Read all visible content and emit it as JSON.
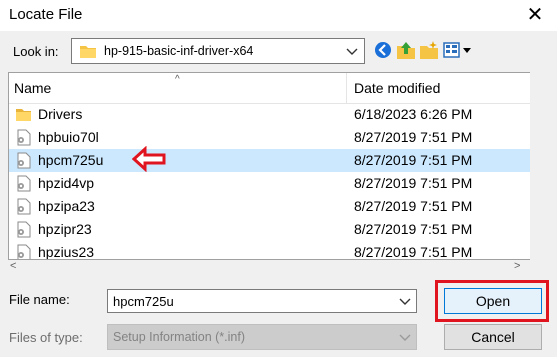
{
  "window": {
    "title": "Locate File",
    "close_glyph": "✕"
  },
  "lookin": {
    "label": "Look in:",
    "value": "hp-915-basic-inf-driver-x64"
  },
  "toolbar": {
    "icons": [
      "back-icon",
      "up-folder-icon",
      "new-folder-icon",
      "view-menu-icon"
    ]
  },
  "list": {
    "columns": {
      "name": "Name",
      "date": "Date modified"
    },
    "sort_glyph": "^",
    "rows": [
      {
        "name": "Drivers",
        "date": "6/18/2023 6:26 PM",
        "type": "folder",
        "selected": false
      },
      {
        "name": "hpbuio70l",
        "date": "8/27/2019 7:51 PM",
        "type": "setup-info",
        "selected": false
      },
      {
        "name": "hpcm725u",
        "date": "8/27/2019 7:51 PM",
        "type": "setup-info",
        "selected": true
      },
      {
        "name": "hpzid4vp",
        "date": "8/27/2019 7:51 PM",
        "type": "setup-info",
        "selected": false
      },
      {
        "name": "hpzipa23",
        "date": "8/27/2019 7:51 PM",
        "type": "setup-info",
        "selected": false
      },
      {
        "name": "hpzipr23",
        "date": "8/27/2019 7:51 PM",
        "type": "setup-info",
        "selected": false
      },
      {
        "name": "hpzius23",
        "date": "8/27/2019 7:51 PM",
        "type": "setup-info",
        "selected": false
      }
    ]
  },
  "scroll": {
    "left_glyph": "<",
    "right_glyph": ">"
  },
  "filename": {
    "label": "File name:",
    "value": "hpcm725u"
  },
  "filetype": {
    "label": "Files of type:",
    "value": "Setup Information (*.inf)"
  },
  "buttons": {
    "open": "Open",
    "cancel": "Cancel"
  },
  "colors": {
    "selection": "#cce8ff",
    "annotation_red": "#e0141e",
    "open_border": "#0078d7"
  }
}
